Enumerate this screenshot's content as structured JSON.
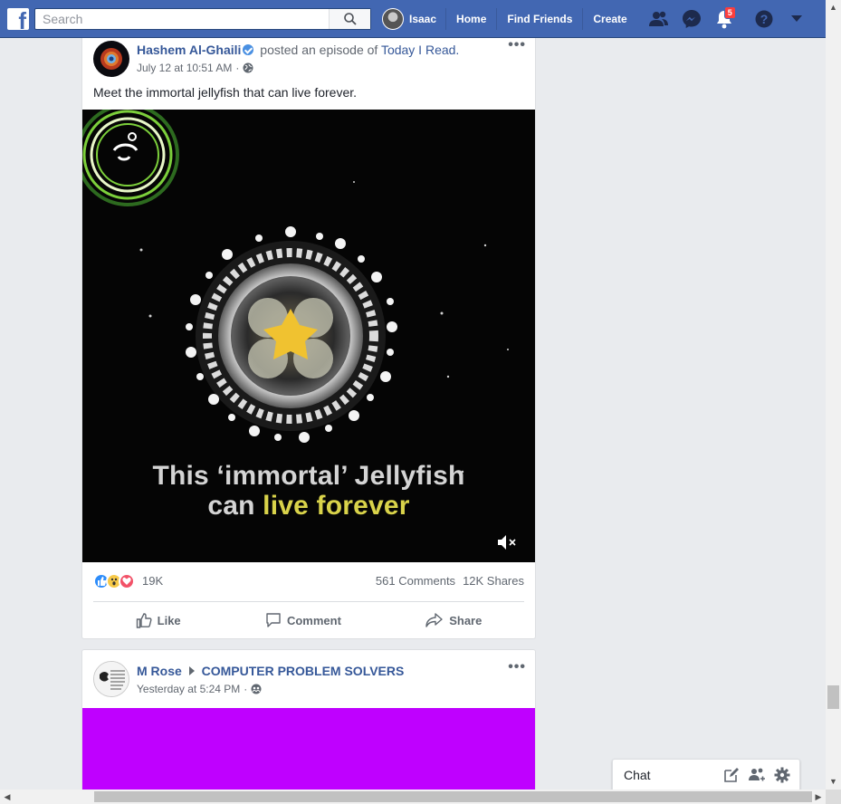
{
  "topbar": {
    "search_placeholder": "Search",
    "user_name": "Isaac",
    "nav_links": [
      "Home",
      "Find Friends",
      "Create"
    ],
    "notifications_count": "5"
  },
  "posts": [
    {
      "author": "Hashem Al-Ghaili",
      "verified": true,
      "action_text": "posted an episode of",
      "page": "Today I Read.",
      "timestamp": "July 12 at 10:51 AM",
      "privacy_sep": "·",
      "text": "Meet the immortal jellyfish that can live forever.",
      "video": {
        "caption_line1": "This ‘immortal’ Jellyfish",
        "caption_line2_a": "can ",
        "caption_line2_b": "live forever"
      },
      "reactions_count": "19K",
      "comments": "561 Comments",
      "shares": "12K Shares",
      "actions": [
        "Like",
        "Comment",
        "Share"
      ]
    },
    {
      "author": "M Rose",
      "target": "COMPUTER PROBLEM SOLVERS",
      "timestamp": "Yesterday at 5:24 PM",
      "privacy_sep": "·"
    }
  ],
  "chat": {
    "label": "Chat"
  },
  "colors": {
    "brand_blue": "#4267b2",
    "link_blue": "#365899",
    "badge_red": "#fa3e3e",
    "caption_highlight": "#d9d34a",
    "purple_block": "#bf00ff"
  }
}
